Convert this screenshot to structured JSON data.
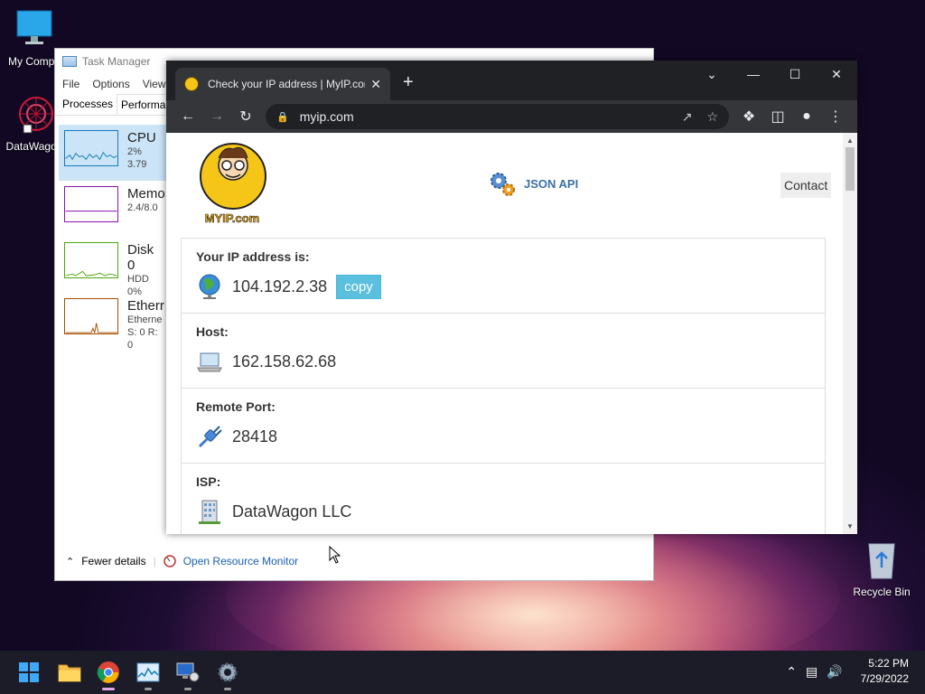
{
  "desktop": {
    "icons": [
      {
        "label": "My Compu"
      },
      {
        "label": "DataWagon"
      },
      {
        "label": "Recycle Bin"
      }
    ]
  },
  "task_manager": {
    "title": "Task Manager",
    "menu": [
      "File",
      "Options",
      "View"
    ],
    "tabs": [
      "Processes",
      "Performan"
    ],
    "items": [
      {
        "name": "CPU",
        "sub1": "2% 3.79",
        "sub2": "",
        "color": "#117dbb"
      },
      {
        "name": "Memo",
        "sub1": "2.4/8.0",
        "sub2": "",
        "color": "#8b12ae"
      },
      {
        "name": "Disk 0",
        "sub1": "HDD",
        "sub2": "0%",
        "color": "#4da60c"
      },
      {
        "name": "Etherr",
        "sub1": "Etherne",
        "sub2": "S: 0 R: 0",
        "color": "#a74f01"
      }
    ],
    "fewer_details": "Fewer details",
    "open_resource_monitor": "Open Resource Monitor"
  },
  "browser": {
    "tab_title": "Check your IP address | MyIP.com",
    "url": "myip.com",
    "page": {
      "logo_text": "MYIP.com",
      "json_api": "JSON API",
      "contact": "Contact",
      "rows": [
        {
          "label": "Your IP address is:",
          "value": "104.192.2.38",
          "icon": "globe-icon"
        },
        {
          "label": "Host:",
          "value": "162.158.62.68",
          "icon": "laptop-icon"
        },
        {
          "label": "Remote Port:",
          "value": "28418",
          "icon": "plug-icon"
        },
        {
          "label": "ISP:",
          "value": "DataWagon LLC",
          "icon": "building-icon"
        }
      ],
      "copy_label": "copy"
    }
  },
  "taskbar": {
    "time": "5:22 PM",
    "date": "7/29/2022"
  }
}
